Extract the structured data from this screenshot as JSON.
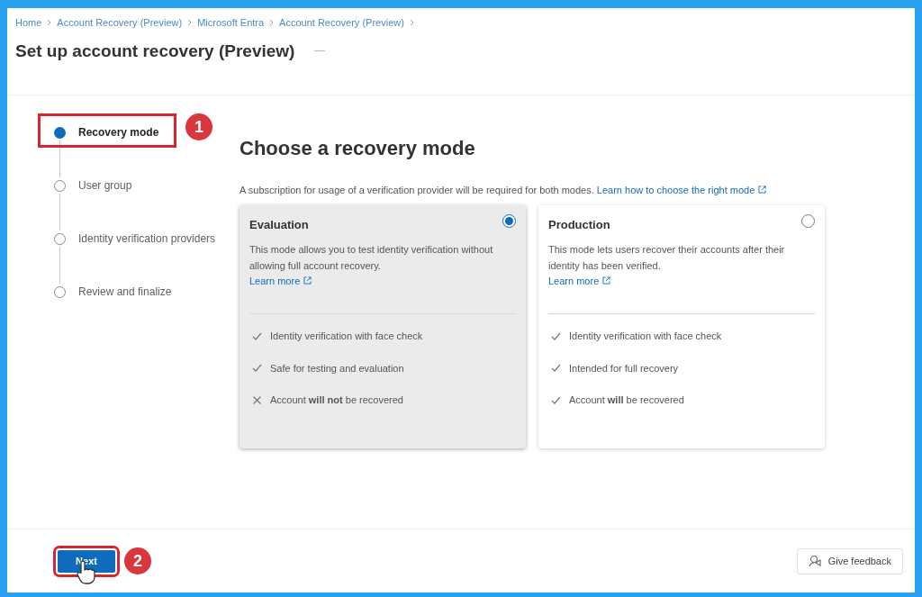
{
  "breadcrumb": [
    "Home",
    "Account Recovery (Preview)",
    "Microsoft Entra",
    "Account Recovery (Preview)"
  ],
  "title": "Set up account recovery (Preview)",
  "steps": [
    {
      "label": "Recovery mode",
      "selected": true,
      "annotation": "1"
    },
    {
      "label": "User group",
      "selected": false
    },
    {
      "label": "Identity verification providers",
      "selected": false
    },
    {
      "label": "Review and finalize",
      "selected": false
    }
  ],
  "heading": "Choose a recovery mode",
  "description": {
    "text": "A subscription for usage of a verification provider will be required for both modes.",
    "link": "Learn how to choose the right mode"
  },
  "options": [
    {
      "title": "Evaluation",
      "selected": true,
      "description": "This mode allows you to test identity verification without allowing full account recovery.",
      "link": "Learn more",
      "features": [
        {
          "kind": "check",
          "text": "Identity verification with face check"
        },
        {
          "kind": "check",
          "text": "Safe for testing and evaluation"
        },
        {
          "kind": "cross",
          "text": "Account **will not** be recovered"
        }
      ]
    },
    {
      "title": "Production",
      "selected": false,
      "description": "This mode lets users recover their accounts after their identity has been verified.",
      "link": "Learn more",
      "features": [
        {
          "kind": "check",
          "text": "Identity verification with face check"
        },
        {
          "kind": "check",
          "text": "Intended for full recovery"
        },
        {
          "kind": "check",
          "text": "Account **will** be recovered"
        }
      ]
    }
  ],
  "next_button": {
    "label": "Next",
    "annotation": "2"
  },
  "feedback_button": "Give feedback"
}
